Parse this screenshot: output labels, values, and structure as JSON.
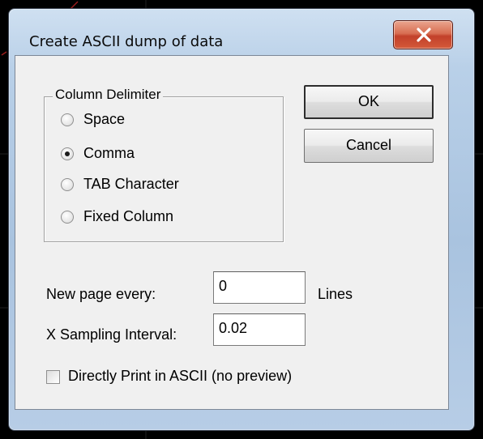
{
  "window": {
    "title": "Create ASCII dump of data"
  },
  "column_delimiter": {
    "legend": "Column Delimiter",
    "options": [
      {
        "label": "Space",
        "selected": false
      },
      {
        "label": "Comma",
        "selected": true
      },
      {
        "label": "TAB Character",
        "selected": false
      },
      {
        "label": "Fixed Column",
        "selected": false
      }
    ]
  },
  "buttons": {
    "ok_label": "OK",
    "cancel_label": "Cancel"
  },
  "fields": {
    "new_page_label": "New page every:",
    "new_page_value": "0",
    "new_page_unit": "Lines",
    "sampling_label": "X Sampling Interval:",
    "sampling_value": "0.02"
  },
  "direct_print": {
    "label": "Directly Print in ASCII (no preview)",
    "checked": false
  },
  "colors": {
    "backdrop": "#000000",
    "frame": "#b9d0e8",
    "close_button": "#c2402a",
    "client": "#f0f0f0"
  }
}
